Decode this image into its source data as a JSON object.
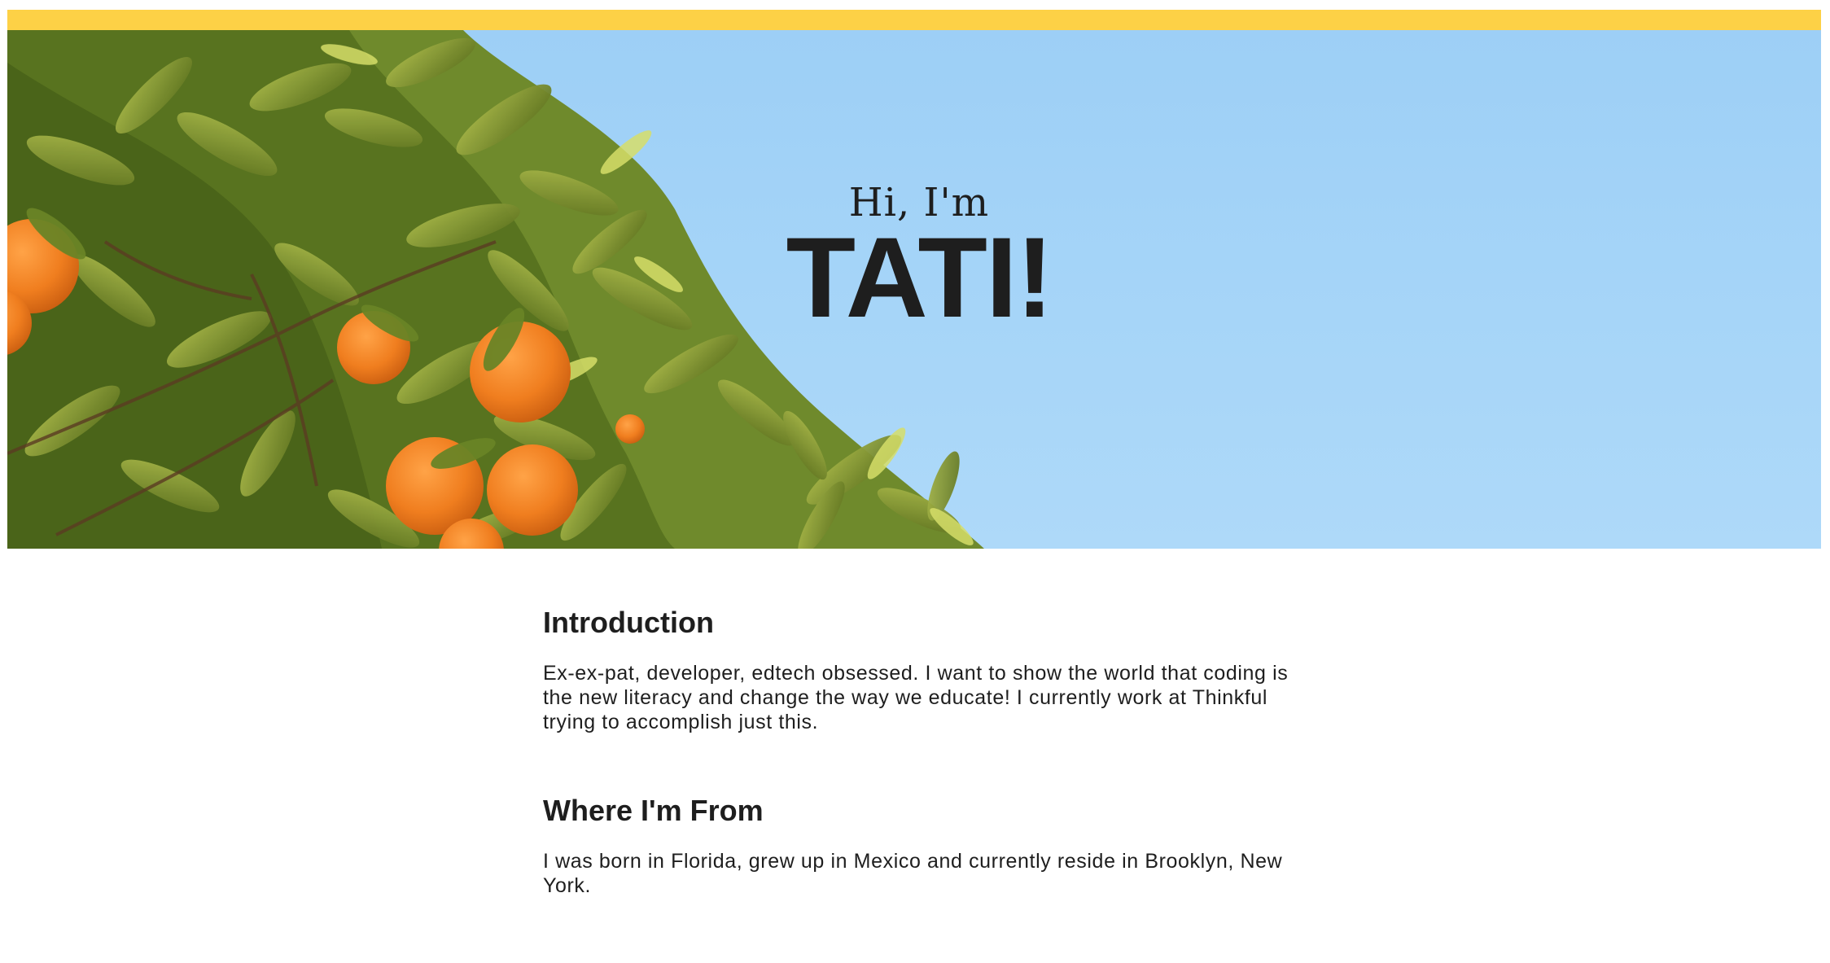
{
  "header": {
    "accent_color": "#fdd146",
    "sky_color": "#a6d5f8",
    "greeting": "Hi, I'm",
    "name": "TATI!"
  },
  "sections": [
    {
      "title": "Introduction",
      "text": "Ex-ex-pat, developer, edtech obsessed. I want to show the world that coding is the new literacy and change the way we educate! I currently work at Thinkful trying to accomplish just this."
    },
    {
      "title": "Where I'm From",
      "text": "I was born in Florida, grew up in Mexico and currently reside in Brooklyn, New York."
    }
  ]
}
